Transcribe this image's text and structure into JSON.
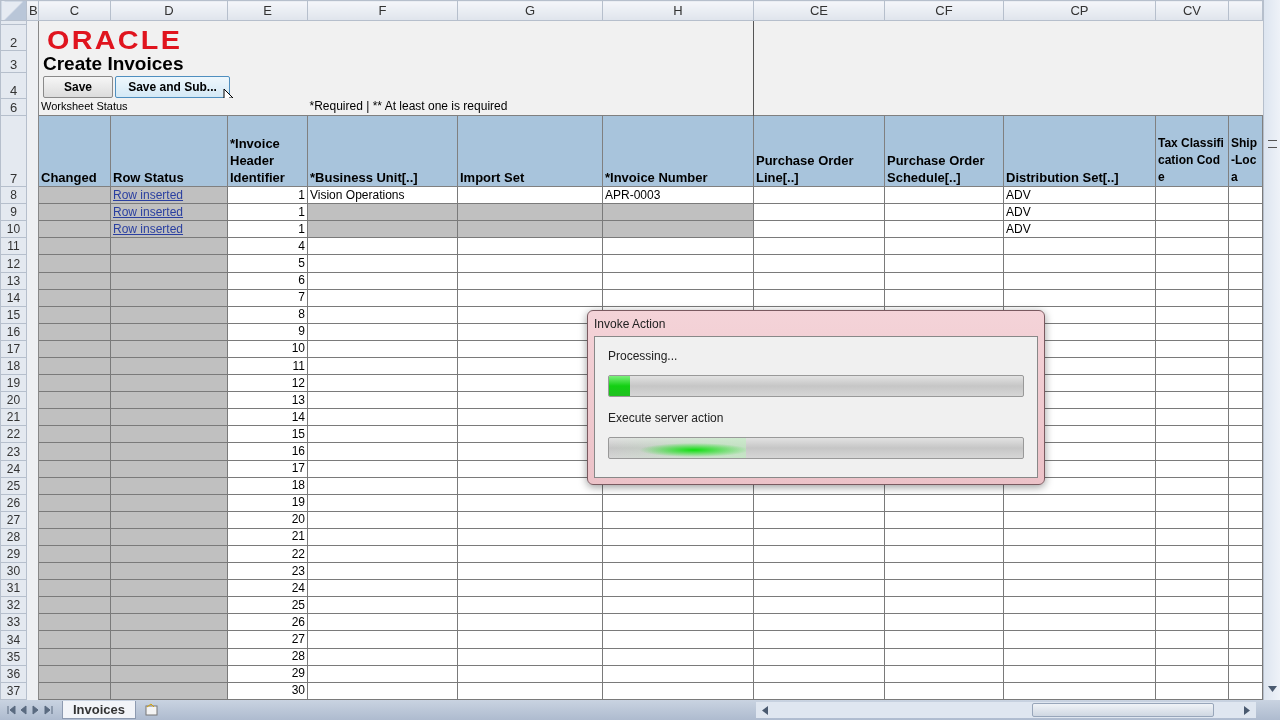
{
  "sheet": {
    "column_letters": [
      "B",
      "C",
      "D",
      "E",
      "F",
      "G",
      "H",
      "CE",
      "CF",
      "CP",
      "CV"
    ],
    "logo": "ORACLE",
    "title": "Create Invoices",
    "buttons": [
      {
        "label": "Save"
      },
      {
        "label": "Save and Sub..."
      }
    ],
    "worksheet_status": "Worksheet Status",
    "required_note": "*Required | ** At least one is required",
    "top_row_numbers": [
      "2",
      "3",
      "4",
      "6",
      "7"
    ],
    "columns": [
      "Changed",
      "Row Status",
      "*Invoice Header Identifier",
      "*Business Unit[..]",
      "Import Set",
      "*Invoice Number",
      "Purchase Order Line[..]",
      "Purchase Order Schedule[..]",
      "Distribution Set[..]",
      "Tax Classification Code",
      "Ship-Loca"
    ],
    "rows": [
      {
        "number": "8",
        "row_status": "Row inserted",
        "identifier": "1",
        "business_unit": "Vision Operations",
        "invoice_number": "APR-0003",
        "distribution_set": "ADV",
        "read_only": false
      },
      {
        "number": "9",
        "row_status": "Row inserted",
        "identifier": "1",
        "distribution_set": "ADV",
        "read_only": true
      },
      {
        "number": "10",
        "row_status": "Row inserted",
        "identifier": "1",
        "distribution_set": "ADV",
        "read_only": true
      },
      {
        "number": "11",
        "identifier": "4",
        "read_only": false
      },
      {
        "number": "12",
        "identifier": "5",
        "read_only": false
      },
      {
        "number": "13",
        "identifier": "6",
        "read_only": false
      },
      {
        "number": "14",
        "identifier": "7",
        "read_only": false
      },
      {
        "number": "15",
        "identifier": "8",
        "read_only": false
      },
      {
        "number": "16",
        "identifier": "9",
        "read_only": false
      },
      {
        "number": "17",
        "identifier": "10",
        "read_only": false
      },
      {
        "number": "18",
        "identifier": "11",
        "read_only": false
      },
      {
        "number": "19",
        "identifier": "12",
        "read_only": false
      },
      {
        "number": "20",
        "identifier": "13",
        "read_only": false
      },
      {
        "number": "21",
        "identifier": "14",
        "read_only": false
      },
      {
        "number": "22",
        "identifier": "15",
        "read_only": false
      },
      {
        "number": "23",
        "identifier": "16",
        "read_only": false
      },
      {
        "number": "24",
        "identifier": "17",
        "read_only": false
      },
      {
        "number": "25",
        "identifier": "18",
        "read_only": false
      },
      {
        "number": "26",
        "identifier": "19",
        "read_only": false
      },
      {
        "number": "27",
        "identifier": "20",
        "read_only": false
      },
      {
        "number": "28",
        "identifier": "21",
        "read_only": false
      },
      {
        "number": "29",
        "identifier": "22",
        "read_only": false
      },
      {
        "number": "30",
        "identifier": "23",
        "read_only": false
      },
      {
        "number": "31",
        "identifier": "24",
        "read_only": false
      },
      {
        "number": "32",
        "identifier": "25",
        "read_only": false
      },
      {
        "number": "33",
        "identifier": "26",
        "read_only": false
      },
      {
        "number": "34",
        "identifier": "27",
        "read_only": false
      },
      {
        "number": "35",
        "identifier": "28",
        "read_only": false
      },
      {
        "number": "36",
        "identifier": "29",
        "read_only": false
      },
      {
        "number": "37",
        "identifier": "30",
        "read_only": false
      }
    ]
  },
  "dialog": {
    "title": "Invoke Action",
    "steps": [
      {
        "kind": "progress",
        "label": "Processing...",
        "level": 0.05
      },
      {
        "kind": "marquee",
        "label": "Execute server action",
        "level": 0.33
      }
    ]
  },
  "sheet_tabs": [
    {
      "label": "Invoices",
      "selected": true
    }
  ]
}
